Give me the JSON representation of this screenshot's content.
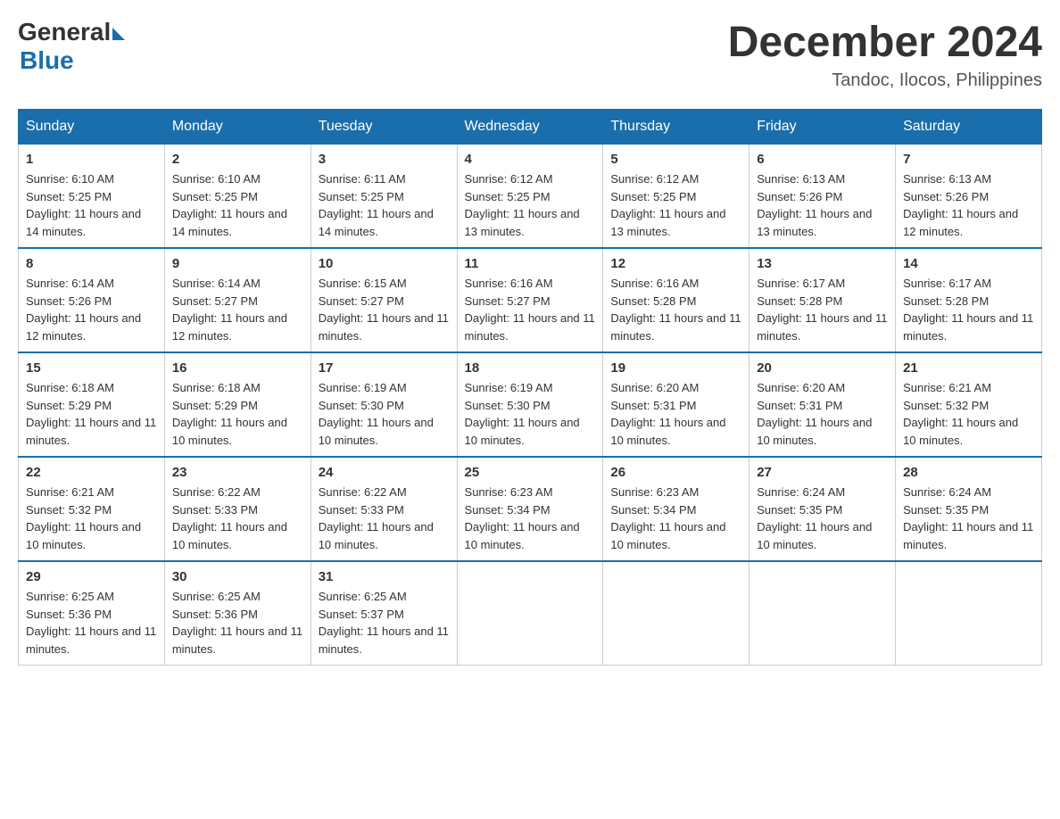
{
  "header": {
    "logo_general": "General",
    "logo_blue": "Blue",
    "month_year": "December 2024",
    "location": "Tandoc, Ilocos, Philippines"
  },
  "days_of_week": [
    "Sunday",
    "Monday",
    "Tuesday",
    "Wednesday",
    "Thursday",
    "Friday",
    "Saturday"
  ],
  "weeks": [
    [
      {
        "day": "1",
        "sunrise": "6:10 AM",
        "sunset": "5:25 PM",
        "daylight": "11 hours and 14 minutes."
      },
      {
        "day": "2",
        "sunrise": "6:10 AM",
        "sunset": "5:25 PM",
        "daylight": "11 hours and 14 minutes."
      },
      {
        "day": "3",
        "sunrise": "6:11 AM",
        "sunset": "5:25 PM",
        "daylight": "11 hours and 14 minutes."
      },
      {
        "day": "4",
        "sunrise": "6:12 AM",
        "sunset": "5:25 PM",
        "daylight": "11 hours and 13 minutes."
      },
      {
        "day": "5",
        "sunrise": "6:12 AM",
        "sunset": "5:25 PM",
        "daylight": "11 hours and 13 minutes."
      },
      {
        "day": "6",
        "sunrise": "6:13 AM",
        "sunset": "5:26 PM",
        "daylight": "11 hours and 13 minutes."
      },
      {
        "day": "7",
        "sunrise": "6:13 AM",
        "sunset": "5:26 PM",
        "daylight": "11 hours and 12 minutes."
      }
    ],
    [
      {
        "day": "8",
        "sunrise": "6:14 AM",
        "sunset": "5:26 PM",
        "daylight": "11 hours and 12 minutes."
      },
      {
        "day": "9",
        "sunrise": "6:14 AM",
        "sunset": "5:27 PM",
        "daylight": "11 hours and 12 minutes."
      },
      {
        "day": "10",
        "sunrise": "6:15 AM",
        "sunset": "5:27 PM",
        "daylight": "11 hours and 11 minutes."
      },
      {
        "day": "11",
        "sunrise": "6:16 AM",
        "sunset": "5:27 PM",
        "daylight": "11 hours and 11 minutes."
      },
      {
        "day": "12",
        "sunrise": "6:16 AM",
        "sunset": "5:28 PM",
        "daylight": "11 hours and 11 minutes."
      },
      {
        "day": "13",
        "sunrise": "6:17 AM",
        "sunset": "5:28 PM",
        "daylight": "11 hours and 11 minutes."
      },
      {
        "day": "14",
        "sunrise": "6:17 AM",
        "sunset": "5:28 PM",
        "daylight": "11 hours and 11 minutes."
      }
    ],
    [
      {
        "day": "15",
        "sunrise": "6:18 AM",
        "sunset": "5:29 PM",
        "daylight": "11 hours and 11 minutes."
      },
      {
        "day": "16",
        "sunrise": "6:18 AM",
        "sunset": "5:29 PM",
        "daylight": "11 hours and 10 minutes."
      },
      {
        "day": "17",
        "sunrise": "6:19 AM",
        "sunset": "5:30 PM",
        "daylight": "11 hours and 10 minutes."
      },
      {
        "day": "18",
        "sunrise": "6:19 AM",
        "sunset": "5:30 PM",
        "daylight": "11 hours and 10 minutes."
      },
      {
        "day": "19",
        "sunrise": "6:20 AM",
        "sunset": "5:31 PM",
        "daylight": "11 hours and 10 minutes."
      },
      {
        "day": "20",
        "sunrise": "6:20 AM",
        "sunset": "5:31 PM",
        "daylight": "11 hours and 10 minutes."
      },
      {
        "day": "21",
        "sunrise": "6:21 AM",
        "sunset": "5:32 PM",
        "daylight": "11 hours and 10 minutes."
      }
    ],
    [
      {
        "day": "22",
        "sunrise": "6:21 AM",
        "sunset": "5:32 PM",
        "daylight": "11 hours and 10 minutes."
      },
      {
        "day": "23",
        "sunrise": "6:22 AM",
        "sunset": "5:33 PM",
        "daylight": "11 hours and 10 minutes."
      },
      {
        "day": "24",
        "sunrise": "6:22 AM",
        "sunset": "5:33 PM",
        "daylight": "11 hours and 10 minutes."
      },
      {
        "day": "25",
        "sunrise": "6:23 AM",
        "sunset": "5:34 PM",
        "daylight": "11 hours and 10 minutes."
      },
      {
        "day": "26",
        "sunrise": "6:23 AM",
        "sunset": "5:34 PM",
        "daylight": "11 hours and 10 minutes."
      },
      {
        "day": "27",
        "sunrise": "6:24 AM",
        "sunset": "5:35 PM",
        "daylight": "11 hours and 10 minutes."
      },
      {
        "day": "28",
        "sunrise": "6:24 AM",
        "sunset": "5:35 PM",
        "daylight": "11 hours and 11 minutes."
      }
    ],
    [
      {
        "day": "29",
        "sunrise": "6:25 AM",
        "sunset": "5:36 PM",
        "daylight": "11 hours and 11 minutes."
      },
      {
        "day": "30",
        "sunrise": "6:25 AM",
        "sunset": "5:36 PM",
        "daylight": "11 hours and 11 minutes."
      },
      {
        "day": "31",
        "sunrise": "6:25 AM",
        "sunset": "5:37 PM",
        "daylight": "11 hours and 11 minutes."
      },
      null,
      null,
      null,
      null
    ]
  ]
}
